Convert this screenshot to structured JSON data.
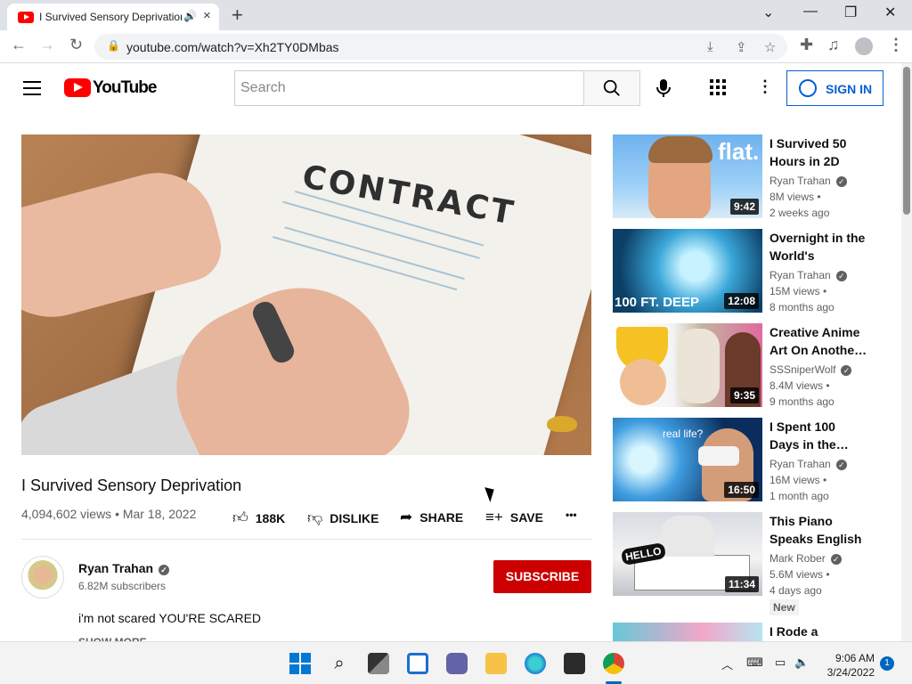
{
  "browser": {
    "tab_title": "I Survived Sensory Deprivation - YouTube",
    "url": "youtube.com/watch?v=Xh2TY0DMbas",
    "new_tab": "+",
    "win_min": "—",
    "win_restore": "❐",
    "win_close": "✕",
    "win_chevron": "⌄"
  },
  "yt": {
    "logo_text": "YouTube",
    "search_placeholder": "Search",
    "signin_label": "SIGN IN"
  },
  "video": {
    "title": "I Survived Sensory Deprivation",
    "meta": "4,094,602 views • Mar 18, 2022",
    "contract_text": "CONTRACT",
    "likes": "188K",
    "dislike_label": "DISLIKE",
    "share_label": "SHARE",
    "save_label": "SAVE",
    "more": "•••"
  },
  "channel": {
    "name": "Ryan Trahan",
    "subscribers": "6.82M subscribers",
    "subscribe_label": "SUBSCRIBE",
    "description": "i'm not scared YOU'RE SCARED",
    "show_more": "SHOW MORE"
  },
  "recommendations": [
    {
      "title": "I Survived 50 Hours in 2D",
      "channel": "Ryan Trahan",
      "views": "8M views •",
      "date": "2 weeks ago",
      "duration": "9:42",
      "overlay": "flat."
    },
    {
      "title": "Overnight in the World's Oldest…",
      "channel": "Ryan Trahan",
      "views": "15M views •",
      "date": "8 months ago",
      "duration": "12:08",
      "overlay": "100 FT. DEEP"
    },
    {
      "title": "Creative Anime Art On Anothe…",
      "channel": "SSSniperWolf",
      "views": "8.4M views •",
      "date": "9 months ago",
      "duration": "9:35",
      "overlay": ""
    },
    {
      "title": "I Spent 100 Days in the…",
      "channel": "Ryan Trahan",
      "views": "16M views •",
      "date": "1 month ago",
      "duration": "16:50",
      "overlay": "real life?"
    },
    {
      "title": "This Piano Speaks English",
      "channel": "Mark Rober",
      "views": "5.6M views •",
      "date": "4 days ago",
      "duration": "11:34",
      "overlay": "HELLO",
      "badge": "New"
    },
    {
      "title": "I Rode a",
      "channel": "",
      "views": "",
      "date": "",
      "duration": "",
      "overlay": ""
    }
  ],
  "taskbar": {
    "time": "9:06 AM",
    "date": "3/24/2022",
    "notifications": "1"
  },
  "colors": {
    "yt_red": "#ff0000",
    "subscribe_red": "#cc0000",
    "link_blue": "#065fd4"
  }
}
